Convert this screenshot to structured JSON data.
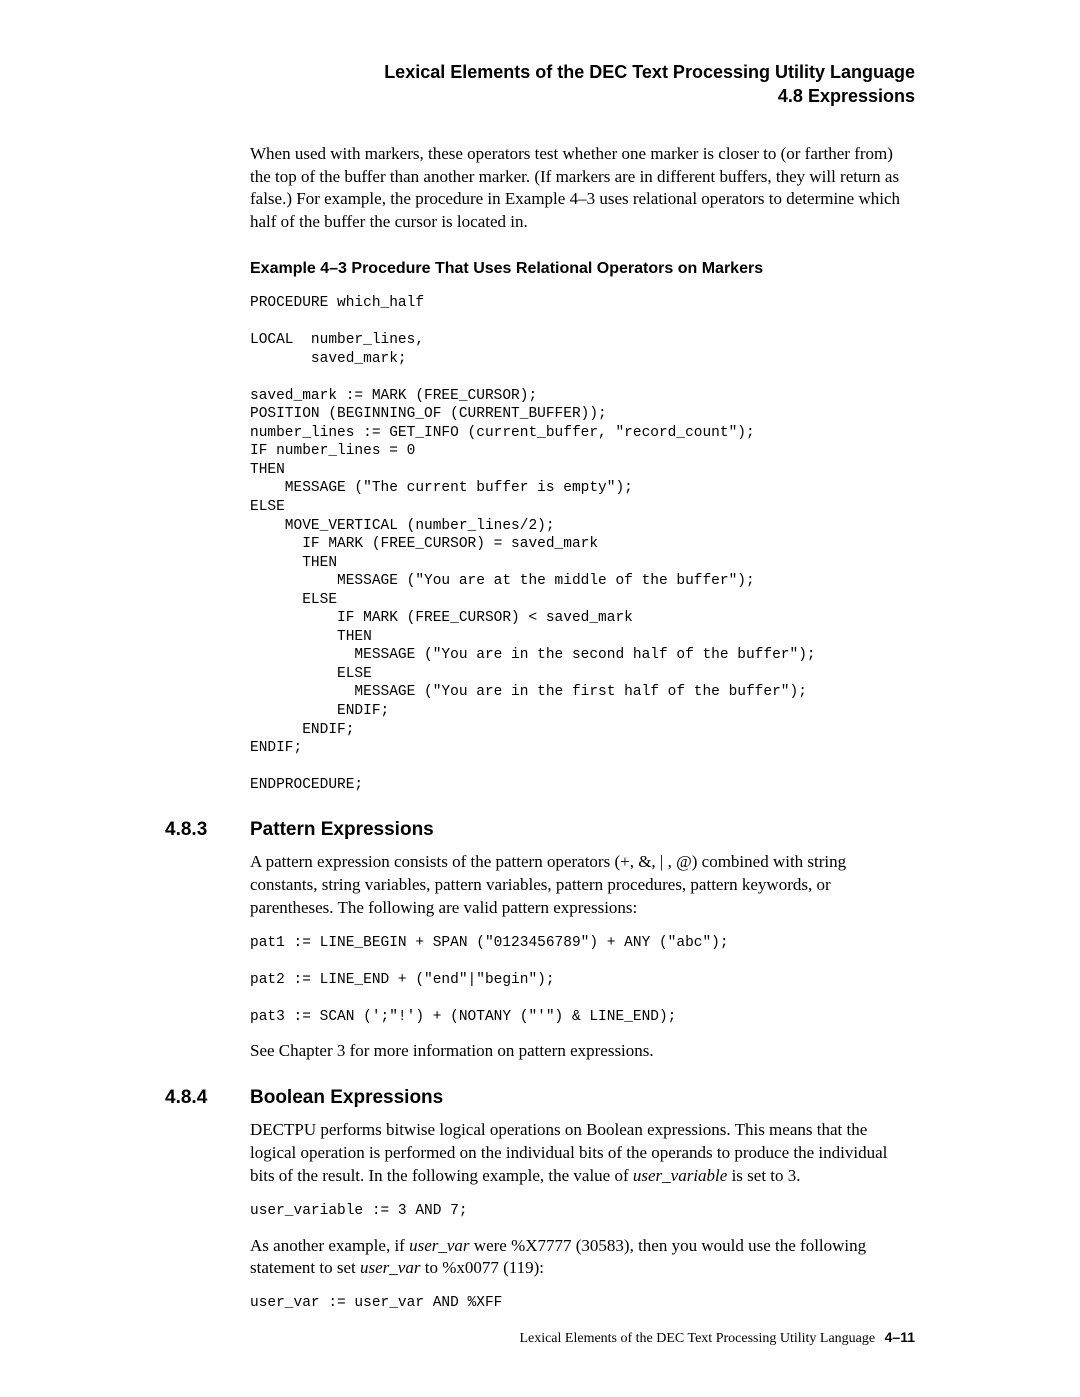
{
  "header": {
    "line1": "Lexical Elements of the DEC Text Processing Utility Language",
    "line2": "4.8 Expressions"
  },
  "intro_para": "When used with markers, these operators test whether one marker is closer to (or farther from) the top of the buffer than another marker. (If markers are in different buffers, they will return as false.) For example, the procedure in Example 4–3 uses relational operators to determine which half of the buffer the cursor is located in.",
  "example": {
    "caption": "Example 4–3   Procedure That Uses Relational Operators on Markers",
    "code": "PROCEDURE which_half\n\nLOCAL  number_lines,\n       saved_mark;\n\nsaved_mark := MARK (FREE_CURSOR);\nPOSITION (BEGINNING_OF (CURRENT_BUFFER));\nnumber_lines := GET_INFO (current_buffer, \"record_count\");\nIF number_lines = 0\nTHEN\n    MESSAGE (\"The current buffer is empty\");\nELSE\n    MOVE_VERTICAL (number_lines/2);\n      IF MARK (FREE_CURSOR) = saved_mark\n      THEN\n          MESSAGE (\"You are at the middle of the buffer\");\n      ELSE\n          IF MARK (FREE_CURSOR) < saved_mark\n          THEN\n            MESSAGE (\"You are in the second half of the buffer\");\n          ELSE\n            MESSAGE (\"You are in the first half of the buffer\");\n          ENDIF;\n      ENDIF;\nENDIF;\n\nENDPROCEDURE;"
  },
  "section483": {
    "num": "4.8.3",
    "title": "Pattern Expressions",
    "para": "A pattern expression consists of the pattern operators (+, &, | , @) combined with string constants, string variables, pattern variables, pattern procedures, pattern keywords, or parentheses. The following are valid pattern expressions:",
    "code": "pat1 := LINE_BEGIN + SPAN (\"0123456789\") + ANY (\"abc\");\n\npat2 := LINE_END + (\"end\"|\"begin\");\n\npat3 := SCAN (';\"!') + (NOTANY (\"'\") & LINE_END);",
    "after": "See Chapter 3 for more information on pattern expressions."
  },
  "section484": {
    "num": "4.8.4",
    "title": "Boolean Expressions",
    "para1_pre": "DECTPU performs bitwise logical operations on Boolean expressions. This means that the logical operation is performed on the individual bits of the operands to produce the individual bits of the result. In the following example, the value of ",
    "para1_ital": "user_variable",
    "para1_post": " is set to 3.",
    "code1": "user_variable := 3 AND 7;",
    "para2_pre": "As another example, if ",
    "para2_ital1": "user_var",
    "para2_mid": " were %X7777 (30583), then you would use the following statement to set ",
    "para2_ital2": "user_var",
    "para2_post": " to %x0077 (119):",
    "code2": "user_var := user_var AND %XFF"
  },
  "footer": {
    "label": "Lexical Elements of the DEC Text Processing Utility Language",
    "page": "4–11"
  }
}
